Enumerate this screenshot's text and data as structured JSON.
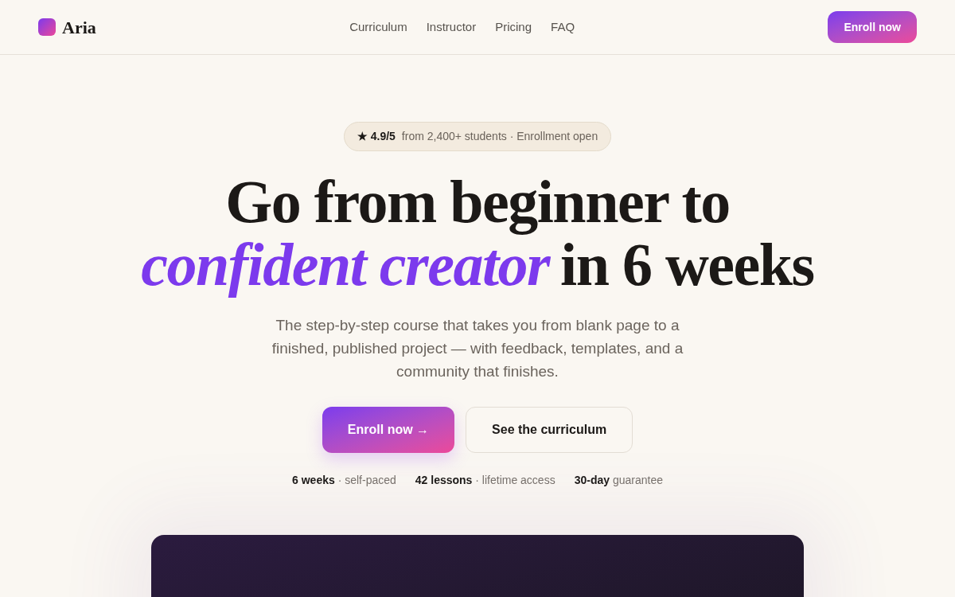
{
  "nav": {
    "brand": "Aria",
    "links": [
      "Curriculum",
      "Instructor",
      "Pricing",
      "FAQ"
    ],
    "cta": "Enroll now"
  },
  "hero": {
    "badge": {
      "rating": "★ 4.9/5",
      "text": "from 2,400+ students · Enrollment open"
    },
    "headline": {
      "line_1": "Go from beginner to",
      "highlight": "confident creator",
      "rest": "in 6 weeks"
    },
    "subtitle": "The step-by-step course that takes you from blank page to a finished, published project — with feedback, templates, and a community that finishes.",
    "buttons": [
      {
        "label": "Enroll now →",
        "kind": "primary"
      },
      {
        "label": "See the curriculum",
        "kind": "secondary"
      }
    ],
    "stats": [
      "**6 weeks** · self-paced",
      "**42 lessons** · lifetime access",
      "**30-day** guarantee"
    ]
  }
}
